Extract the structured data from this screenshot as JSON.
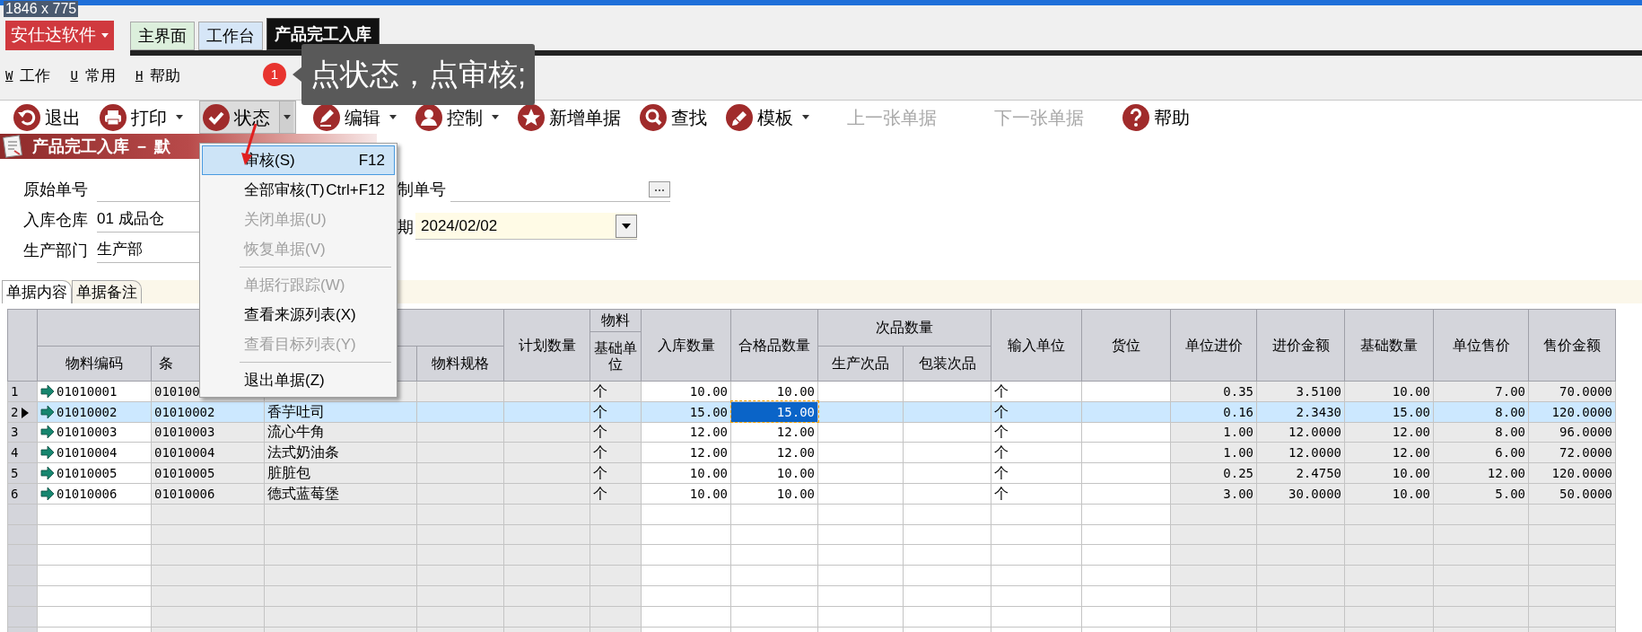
{
  "screen_size_label": "1846 x 775",
  "app_button": {
    "label": "安仕达软件"
  },
  "tabs": [
    {
      "label": "主界面",
      "selected": false,
      "color": "#dcefdc"
    },
    {
      "label": "工作台",
      "selected": false,
      "color": "#d6e6f7"
    },
    {
      "label": "产品完工入库",
      "selected": true,
      "color": "#111111"
    }
  ],
  "menu_bar": [
    {
      "key": "W",
      "label": "工作"
    },
    {
      "key": "U",
      "label": "常用"
    },
    {
      "key": "H",
      "label": "帮助"
    }
  ],
  "callout": {
    "number": "1",
    "text": "点状态，点审核;"
  },
  "toolbar": [
    {
      "label": "退出",
      "dropdown": false,
      "disabled": false,
      "pressed": false
    },
    {
      "label": "打印",
      "dropdown": true,
      "disabled": false,
      "pressed": false
    },
    {
      "label": "状态",
      "dropdown": true,
      "disabled": false,
      "pressed": true
    },
    {
      "label": "编辑",
      "dropdown": true,
      "disabled": false,
      "pressed": false
    },
    {
      "label": "控制",
      "dropdown": true,
      "disabled": false,
      "pressed": false
    },
    {
      "label": "新增单据",
      "dropdown": false,
      "disabled": false,
      "pressed": false
    },
    {
      "label": "查找",
      "dropdown": false,
      "disabled": false,
      "pressed": false
    },
    {
      "label": "模板",
      "dropdown": true,
      "disabled": false,
      "pressed": false
    },
    {
      "label": "上一张单据",
      "dropdown": false,
      "disabled": true,
      "pressed": false
    },
    {
      "label": "下一张单据",
      "dropdown": false,
      "disabled": true,
      "pressed": false
    },
    {
      "label": "帮助",
      "dropdown": false,
      "disabled": false,
      "pressed": false
    }
  ],
  "document_title": "产品完工入库 － 默",
  "status_menu": [
    {
      "kind": "item",
      "label": "审核(S)",
      "shortcut": "F12",
      "disabled": false,
      "selected": true
    },
    {
      "kind": "item",
      "label": "全部审核(T)",
      "shortcut": "Ctrl+F12",
      "disabled": false,
      "selected": false
    },
    {
      "kind": "item",
      "label": "关闭单据(U)",
      "disabled": true,
      "selected": false
    },
    {
      "kind": "item",
      "label": "恢复单据(V)",
      "disabled": true,
      "selected": false
    },
    {
      "kind": "separator"
    },
    {
      "kind": "item",
      "label": "单据行跟踪(W)",
      "disabled": true,
      "selected": false
    },
    {
      "kind": "item",
      "label": "查看来源列表(X)",
      "disabled": false,
      "selected": false
    },
    {
      "kind": "item",
      "label": "查看目标列表(Y)",
      "disabled": true,
      "selected": false
    },
    {
      "kind": "separator"
    },
    {
      "kind": "item",
      "label": "退出单据(Z)",
      "disabled": false,
      "selected": false
    }
  ],
  "form": {
    "left": [
      {
        "label": "原始单号"
      },
      {
        "label": "入库仓库",
        "value": "01  成品仓"
      },
      {
        "label": "生产部门",
        "value": "生产部"
      }
    ],
    "right": [
      {
        "label": "制单号",
        "kind": "browse"
      },
      {
        "label": "期",
        "kind": "date",
        "value": "2024/02/02"
      }
    ]
  },
  "detail_tabs": [
    {
      "label": "单据内容",
      "selected": true
    },
    {
      "label": "单据备注",
      "selected": false
    }
  ],
  "table": {
    "header": [
      {
        "columns": [
          {
            "label": "物料编码"
          },
          {
            "label": "条"
          },
          {},
          {
            "label": "物料规格"
          }
        ]
      },
      {
        "label": "计划数量"
      },
      {
        "group": "物料",
        "columns": [
          {
            "label": "基础单位"
          }
        ]
      },
      {
        "label": "入库数量"
      },
      {
        "label": "合格品数量"
      },
      {
        "group": "次品数量",
        "columns": [
          {
            "label": "生产次品"
          },
          {
            "label": "包装次品"
          }
        ]
      },
      {
        "label": "输入单位"
      },
      {
        "label": "货位"
      },
      {
        "label": "单位进价"
      },
      {
        "label": "进价金额"
      },
      {
        "label": "基础数量"
      },
      {
        "label": "单位售价"
      },
      {
        "label": "售价金额"
      }
    ],
    "rows": [
      {
        "number": "1",
        "selected": false,
        "cells": [
          {
            "text": "01010001"
          },
          {
            "text": "010100"
          },
          {},
          {},
          {},
          {
            "text": "个"
          },
          {
            "text": "10.00"
          },
          {
            "text": "10.00"
          },
          {},
          {},
          {
            "text": "个"
          },
          {},
          {
            "text": "0.35"
          },
          {
            "text": "3.5100"
          },
          {
            "text": "10.00"
          },
          {
            "text": "7.00"
          },
          {
            "text": "70.0000"
          }
        ]
      },
      {
        "number": "2",
        "selected": true,
        "cells": [
          {
            "text": "01010002"
          },
          {
            "text": "01010002"
          },
          {
            "text": "香芋吐司"
          },
          {},
          {},
          {
            "text": "个"
          },
          {
            "text": "15.00"
          },
          {
            "text": "15.00",
            "focused": true
          },
          {},
          {},
          {
            "text": "个"
          },
          {},
          {
            "text": "0.16"
          },
          {
            "text": "2.3430"
          },
          {
            "text": "15.00"
          },
          {
            "text": "8.00"
          },
          {
            "text": "120.0000"
          }
        ]
      },
      {
        "number": "3",
        "selected": false,
        "cells": [
          {
            "text": "01010003"
          },
          {
            "text": "01010003"
          },
          {
            "text": "流心牛角"
          },
          {},
          {},
          {
            "text": "个"
          },
          {
            "text": "12.00"
          },
          {
            "text": "12.00"
          },
          {},
          {},
          {
            "text": "个"
          },
          {},
          {
            "text": "1.00"
          },
          {
            "text": "12.0000"
          },
          {
            "text": "12.00"
          },
          {
            "text": "8.00"
          },
          {
            "text": "96.0000"
          }
        ]
      },
      {
        "number": "4",
        "selected": false,
        "cells": [
          {
            "text": "01010004"
          },
          {
            "text": "01010004"
          },
          {
            "text": "法式奶油条"
          },
          {},
          {},
          {
            "text": "个"
          },
          {
            "text": "12.00"
          },
          {
            "text": "12.00"
          },
          {},
          {},
          {
            "text": "个"
          },
          {},
          {
            "text": "1.00"
          },
          {
            "text": "12.0000"
          },
          {
            "text": "12.00"
          },
          {
            "text": "6.00"
          },
          {
            "text": "72.0000"
          }
        ]
      },
      {
        "number": "5",
        "selected": false,
        "cells": [
          {
            "text": "01010005"
          },
          {
            "text": "01010005"
          },
          {
            "text": "脏脏包"
          },
          {},
          {},
          {
            "text": "个"
          },
          {
            "text": "10.00"
          },
          {
            "text": "10.00"
          },
          {},
          {},
          {
            "text": "个"
          },
          {},
          {
            "text": "0.25"
          },
          {
            "text": "2.4750"
          },
          {
            "text": "10.00"
          },
          {
            "text": "12.00"
          },
          {
            "text": "120.0000"
          }
        ]
      },
      {
        "number": "6",
        "selected": false,
        "cells": [
          {
            "text": "01010006"
          },
          {
            "text": "01010006"
          },
          {
            "text": "德式蓝莓堡"
          },
          {},
          {},
          {
            "text": "个"
          },
          {
            "text": "10.00"
          },
          {
            "text": "10.00"
          },
          {},
          {},
          {
            "text": "个"
          },
          {},
          {
            "text": "3.00"
          },
          {
            "text": "30.0000"
          },
          {
            "text": "10.00"
          },
          {
            "text": "5.00"
          },
          {
            "text": "50.0000"
          }
        ]
      }
    ]
  }
}
